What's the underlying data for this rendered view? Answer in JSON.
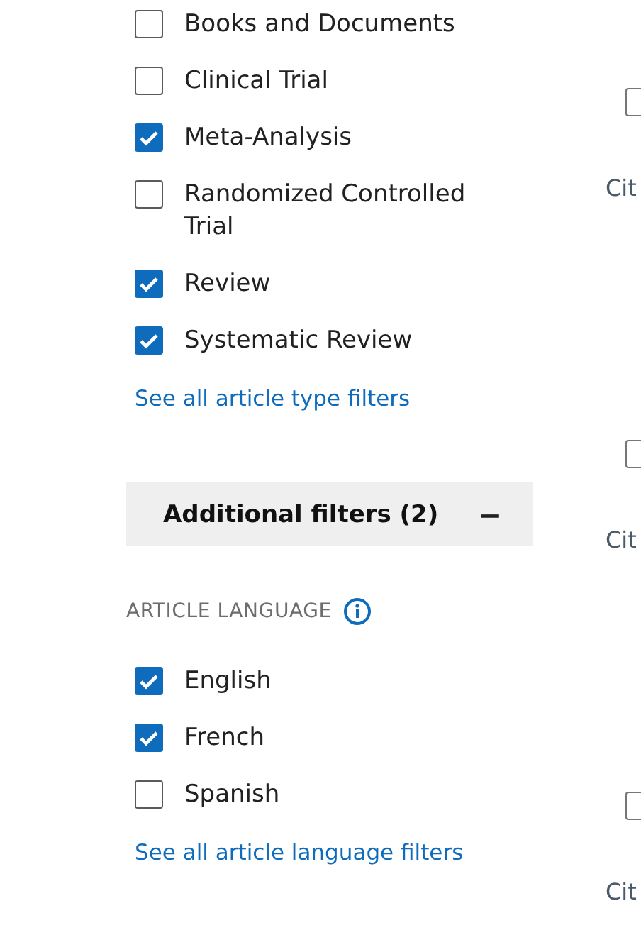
{
  "article_type": {
    "options": [
      {
        "label": "Books and Documents",
        "checked": false
      },
      {
        "label": "Clinical Trial",
        "checked": false
      },
      {
        "label": "Meta-Analysis",
        "checked": true
      },
      {
        "label": "Randomized Controlled Trial",
        "checked": false
      },
      {
        "label": "Review",
        "checked": true
      },
      {
        "label": "Systematic Review",
        "checked": true
      }
    ],
    "see_all_link": "See all article type filters"
  },
  "additional_filters": {
    "title": "Additional filters (2)",
    "toggle": "−",
    "expanded": true
  },
  "article_language": {
    "heading": "ARTICLE LANGUAGE",
    "options": [
      {
        "label": "English",
        "checked": true
      },
      {
        "label": "French",
        "checked": true
      },
      {
        "label": "Spanish",
        "checked": false
      }
    ],
    "see_all_link": "See all article language filters"
  },
  "results": [
    {
      "checked": false,
      "cite": "Cit"
    },
    {
      "checked": false,
      "cite": "Cit"
    },
    {
      "checked": false,
      "cite": "Cit"
    }
  ]
}
